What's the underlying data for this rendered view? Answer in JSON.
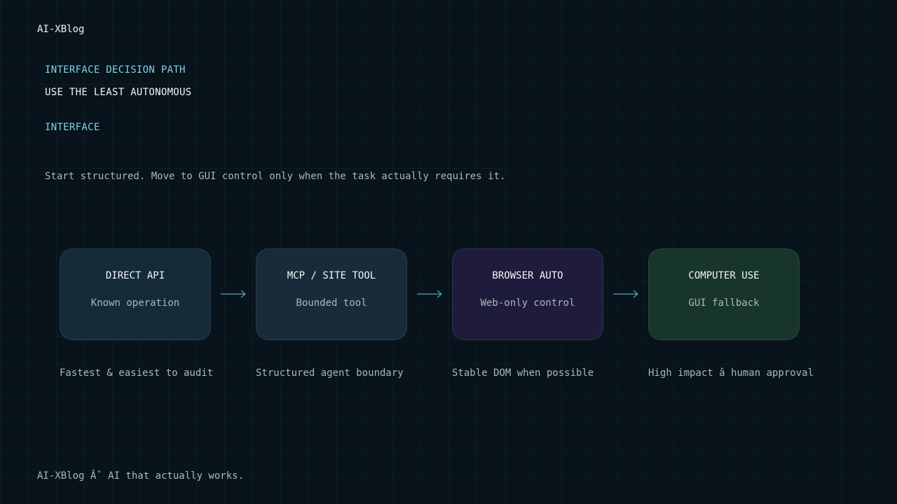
{
  "brand": "AI-XBlog",
  "kicker": "INTERFACE DECISION PATH",
  "title_line1": "USE THE LEAST AUTONOMOUS",
  "title_line2": "INTERFACE",
  "subtitle": "Start structured. Move to GUI control only when the task actually requires it.",
  "footer": "AI-XBlog Âˇ AI that actually works.",
  "colors": {
    "background": "#08131b",
    "accent": "#7fd3ea",
    "box_direct_api": "#152b3a",
    "box_mcp": "#172b3a",
    "box_browser": "#1f1b3c",
    "box_computer": "#18352b",
    "arrow": "#4fa8bf"
  },
  "steps": [
    {
      "label": "DIRECT API",
      "sub": "Known operation",
      "note": "Fastest & easiest to audit"
    },
    {
      "label": "MCP / SITE TOOL",
      "sub": "Bounded tool",
      "note": "Structured agent boundary"
    },
    {
      "label": "BROWSER AUTO",
      "sub": "Web-only control",
      "note": "Stable DOM when possible"
    },
    {
      "label": "COMPUTER USE",
      "sub": "GUI fallback",
      "note": "High impact â   human approval"
    }
  ]
}
